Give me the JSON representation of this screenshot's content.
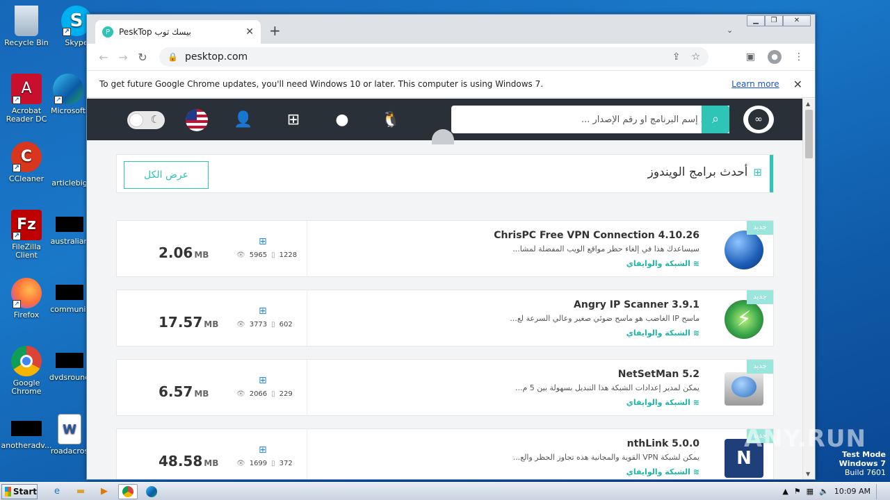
{
  "desktop": {
    "icons": [
      {
        "label": "Recycle Bin"
      },
      {
        "label": "Skype"
      },
      {
        "label": "Acrobat Reader DC"
      },
      {
        "label": "Microsoft"
      },
      {
        "label": "CCleaner"
      },
      {
        "label": "articlebig"
      },
      {
        "label": "FileZilla Client"
      },
      {
        "label": "australian"
      },
      {
        "label": "Firefox"
      },
      {
        "label": "communit"
      },
      {
        "label": "Google Chrome"
      },
      {
        "label": "dvdsround"
      },
      {
        "label": "anotheradv..."
      },
      {
        "label": "roadacros"
      }
    ]
  },
  "browser": {
    "tab_title": "PeskTop بيسك توب",
    "url": "pesktop.com",
    "infobar_text": "To get future Google Chrome updates, you'll need Windows 10 or later. This computer is using Windows 7.",
    "infobar_link": "Learn more"
  },
  "site": {
    "search_placeholder": "أدخل إسم البرنامج او رقم الإصدار ...",
    "section_title": "أحدث برامج الويندوز",
    "view_all": "عرض الكل",
    "new_badge": "جديد",
    "items": [
      {
        "name": "ChrisPC Free VPN Connection 4.10.26",
        "desc": "سيساعدك هذا في إلغاء حظر مواقع الويب المفضلة لمشا...",
        "category": "الشبكة والوايفاي",
        "size": "2.06",
        "unit": "MB",
        "views": "5965",
        "downloads": "1228",
        "color": "#1d5fb8"
      },
      {
        "name": "Angry IP Scanner 3.9.1",
        "desc": "ماسح IP الغاضب هو ماسح ضوئي صغير وعالي السرعة لع...",
        "category": "الشبكة والوايفاي",
        "size": "17.57",
        "unit": "MB",
        "views": "3773",
        "downloads": "602",
        "color": "#3aa64a"
      },
      {
        "name": "NetSetMan 5.2",
        "desc": "يمكن لمدير إعدادات الشبكة هذا التبديل بسهولة بين 5 م...",
        "category": "الشبكة والوايفاي",
        "size": "6.57",
        "unit": "MB",
        "views": "2066",
        "downloads": "229",
        "color": "#5b8fc7"
      },
      {
        "name": "nthLink 5.0.0",
        "desc": "يمكن لشبكة VPN القوية والمجانية هذه تجاوز الحظر والع...",
        "category": "الشبكة والوايفاي",
        "size": "48.58",
        "unit": "MB",
        "views": "1699",
        "downloads": "372",
        "color": "#1f3f7a"
      }
    ]
  },
  "taskbar": {
    "start_label": "Start",
    "clock": "10:09 AM"
  },
  "watermark": "ANY.RUN",
  "testmode": {
    "line1": "Test Mode",
    "line2": "Windows 7",
    "line3": "Build 7601"
  }
}
